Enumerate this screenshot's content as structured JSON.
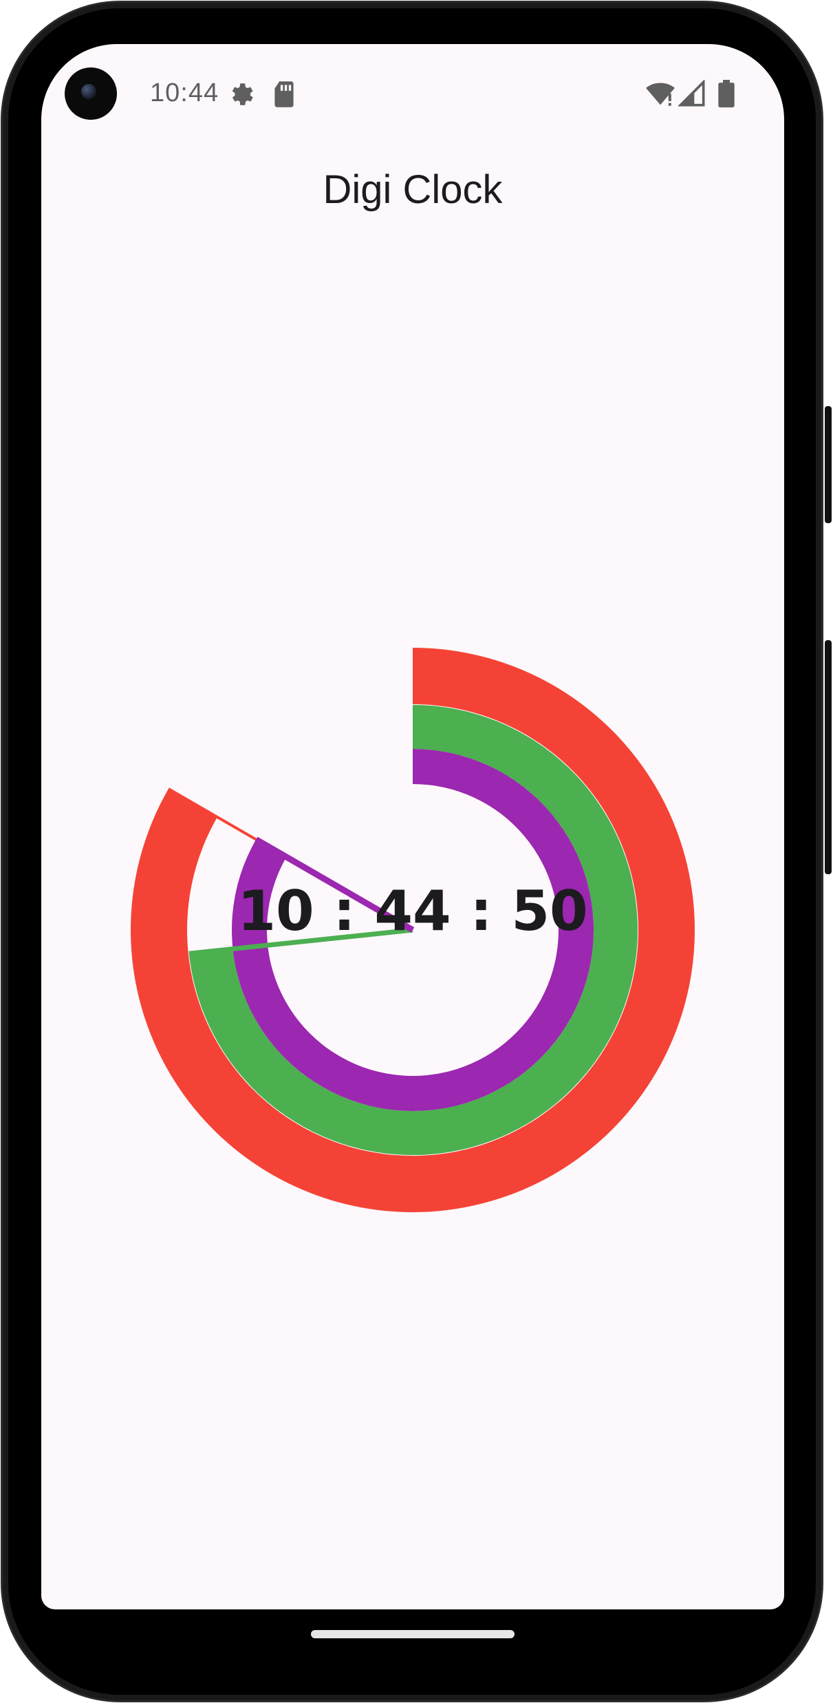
{
  "status_bar": {
    "time": "10:44",
    "icons": [
      "settings-gear-icon",
      "sd-card-icon",
      "wifi-icon",
      "signal-icon",
      "battery-icon"
    ]
  },
  "app": {
    "title": "Digi Clock"
  },
  "clock": {
    "display": "10 : 44 : 50",
    "hours": 10,
    "minutes": 44,
    "seconds": 50,
    "colors": {
      "hours_ring": "#f44336",
      "minutes_ring": "#4caf50",
      "seconds_ring": "#9c27b0",
      "background": "#fdf8fb",
      "text": "#1c1b1f"
    }
  }
}
